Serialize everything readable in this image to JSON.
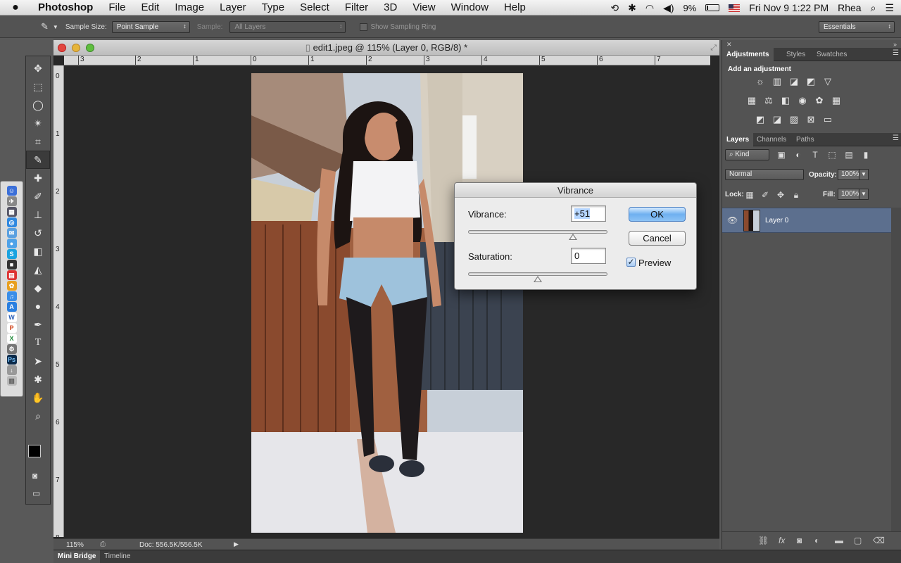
{
  "menubar": {
    "apple": "",
    "app": "Photoshop",
    "items": [
      "File",
      "Edit",
      "Image",
      "Layer",
      "Type",
      "Select",
      "Filter",
      "3D",
      "View",
      "Window",
      "Help"
    ],
    "battery": "9%",
    "datetime": "Fri Nov 9  1:22 PM",
    "user": "Rhea"
  },
  "options": {
    "sample_size_label": "Sample Size:",
    "sample_size_value": "Point Sample",
    "sample_label": "Sample:",
    "sample_value": "All Layers",
    "show_ring_label": "Show Sampling Ring",
    "workspace": "Essentials"
  },
  "document": {
    "title": "edit1.jpeg @ 115% (Layer 0, RGB/8) *",
    "zoom": "115%",
    "doc_size": "Doc: 556.5K/556.5K",
    "h_ruler": [
      "3",
      "2",
      "1",
      "0",
      "1",
      "2",
      "3",
      "4",
      "5",
      "6",
      "7"
    ],
    "v_ruler": [
      "0",
      "1",
      "2",
      "3",
      "4",
      "5",
      "6",
      "7",
      "8"
    ]
  },
  "bottom_tabs": [
    "Mini Bridge",
    "Timeline"
  ],
  "dialog": {
    "title": "Vibrance",
    "vibrance_label": "Vibrance:",
    "vibrance_value": "+51",
    "vibrance_level": 51,
    "saturation_label": "Saturation:",
    "saturation_value": "0",
    "saturation_level": 0,
    "ok": "OK",
    "cancel": "Cancel",
    "preview_label": "Preview",
    "preview_checked": true
  },
  "adjustments": {
    "tabs": [
      "Adjustments",
      "Styles",
      "Swatches"
    ],
    "heading": "Add an adjustment",
    "icons_row1": [
      "brightness-icon",
      "levels-icon",
      "curves-icon",
      "exposure-icon",
      "vibrance-icon"
    ],
    "icons_row2": [
      "hue-saturation-icon",
      "color-balance-icon",
      "black-white-icon",
      "photo-filter-icon",
      "channel-mixer-icon",
      "color-lookup-icon"
    ],
    "icons_row3": [
      "invert-icon",
      "posterize-icon",
      "threshold-icon",
      "selective-color-icon",
      "gradient-map-icon"
    ]
  },
  "layers": {
    "tabs": [
      "Layers",
      "Channels",
      "Paths"
    ],
    "filter": "Kind",
    "blend_mode": "Normal",
    "opacity_label": "Opacity:",
    "opacity": "100%",
    "lock_label": "Lock:",
    "fill_label": "Fill:",
    "fill": "100%",
    "items": [
      {
        "name": "Layer 0"
      }
    ]
  },
  "tools": [
    "move",
    "marquee",
    "lasso",
    "quick-select",
    "crop",
    "eyedropper",
    "healing",
    "brush",
    "clone-stamp",
    "history-brush",
    "eraser",
    "paint-bucket",
    "blur",
    "dodge",
    "pen",
    "type",
    "path-select",
    "shape",
    "hand",
    "zoom"
  ]
}
